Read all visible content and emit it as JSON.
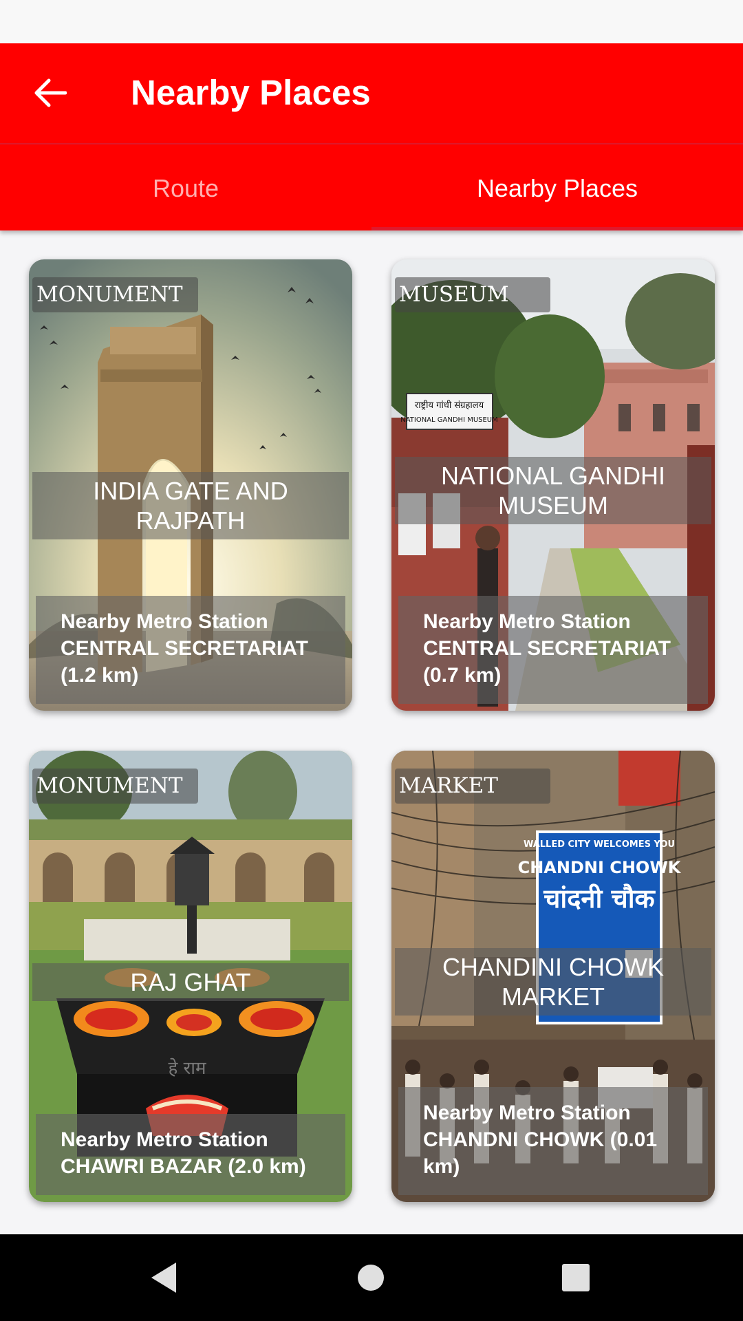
{
  "app_bar": {
    "title": "Nearby Places",
    "back_icon": "arrow-left-icon",
    "color": "#ff0000"
  },
  "tabs": [
    {
      "label": "Route",
      "selected": false
    },
    {
      "label": "Nearby Places",
      "selected": true
    }
  ],
  "places": [
    {
      "category": "MONUMENT",
      "name": "INDIA GATE AND RAJPATH",
      "metro_label": "Nearby Metro Station",
      "metro_value": "CENTRAL SECRETARIAT (1.2 km)"
    },
    {
      "category": "MUSEUM",
      "name": "NATIONAL GANDHI MUSEUM",
      "metro_label": "Nearby Metro Station",
      "metro_value": "CENTRAL SECRETARIAT (0.7 km)",
      "sign_hindi": "राष्ट्रीय गांधी संग्रहालय",
      "sign_english": "NATIONAL GANDHI MUSEUM"
    },
    {
      "category": "MONUMENT",
      "name": "RAJ GHAT",
      "metro_label": "Nearby Metro Station",
      "metro_value": "CHAWRI BAZAR (2.0 km)",
      "stone_text": "हे राम"
    },
    {
      "category": "MARKET",
      "name": "CHANDINI CHOWK MARKET",
      "metro_label": "Nearby Metro Station",
      "metro_value": "CHANDNI CHOWK (0.01 km)",
      "sign_top": "WALLED CITY WELCOMES YOU",
      "sign_main": "CHANDNI CHOWK",
      "sign_hindi": "चांदनी चौक"
    }
  ],
  "nav": {
    "back_icon": "triangle-back-icon",
    "home_icon": "circle-home-icon",
    "recents_icon": "square-recents-icon"
  }
}
